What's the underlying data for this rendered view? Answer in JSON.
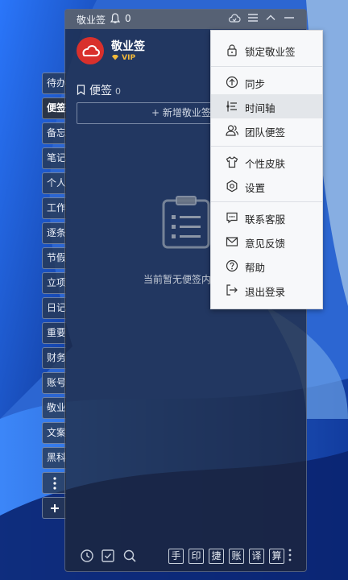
{
  "window": {
    "title": "敬业签",
    "reminder_count": "0"
  },
  "user": {
    "name": "敬业签",
    "badge": "VIP"
  },
  "side_tabs": [
    "待办",
    "便签",
    "备忘",
    "笔记",
    "个人",
    "工作",
    "逐条",
    "节假",
    "立项",
    "日记",
    "重要",
    "财务",
    "账号",
    "敬业",
    "文案",
    "黑科"
  ],
  "notes": {
    "header": "便签",
    "count": "0",
    "add_label": "+ 新增敬业签",
    "empty_text": "当前暂无便签内容"
  },
  "toolbar_buttons": [
    "手",
    "印",
    "捷",
    "账",
    "译",
    "算"
  ],
  "menu": {
    "items": [
      {
        "label": "锁定敬业签",
        "icon": "lock-icon"
      },
      {
        "label": "同步",
        "icon": "sync-icon"
      },
      {
        "label": "时间轴",
        "icon": "timeline-icon"
      },
      {
        "label": "团队便签",
        "icon": "team-icon"
      },
      {
        "label": "个性皮肤",
        "icon": "shirt-icon"
      },
      {
        "label": "设置",
        "icon": "settings-icon"
      },
      {
        "label": "联系客服",
        "icon": "chat-icon"
      },
      {
        "label": "意见反馈",
        "icon": "mail-icon"
      },
      {
        "label": "帮助",
        "icon": "help-icon"
      },
      {
        "label": "退出登录",
        "icon": "logout-icon"
      }
    ]
  },
  "colors": {
    "accent_red": "#d9302c",
    "vip_gold": "#f2b93a",
    "menu_bg": "#f7f8fa"
  }
}
